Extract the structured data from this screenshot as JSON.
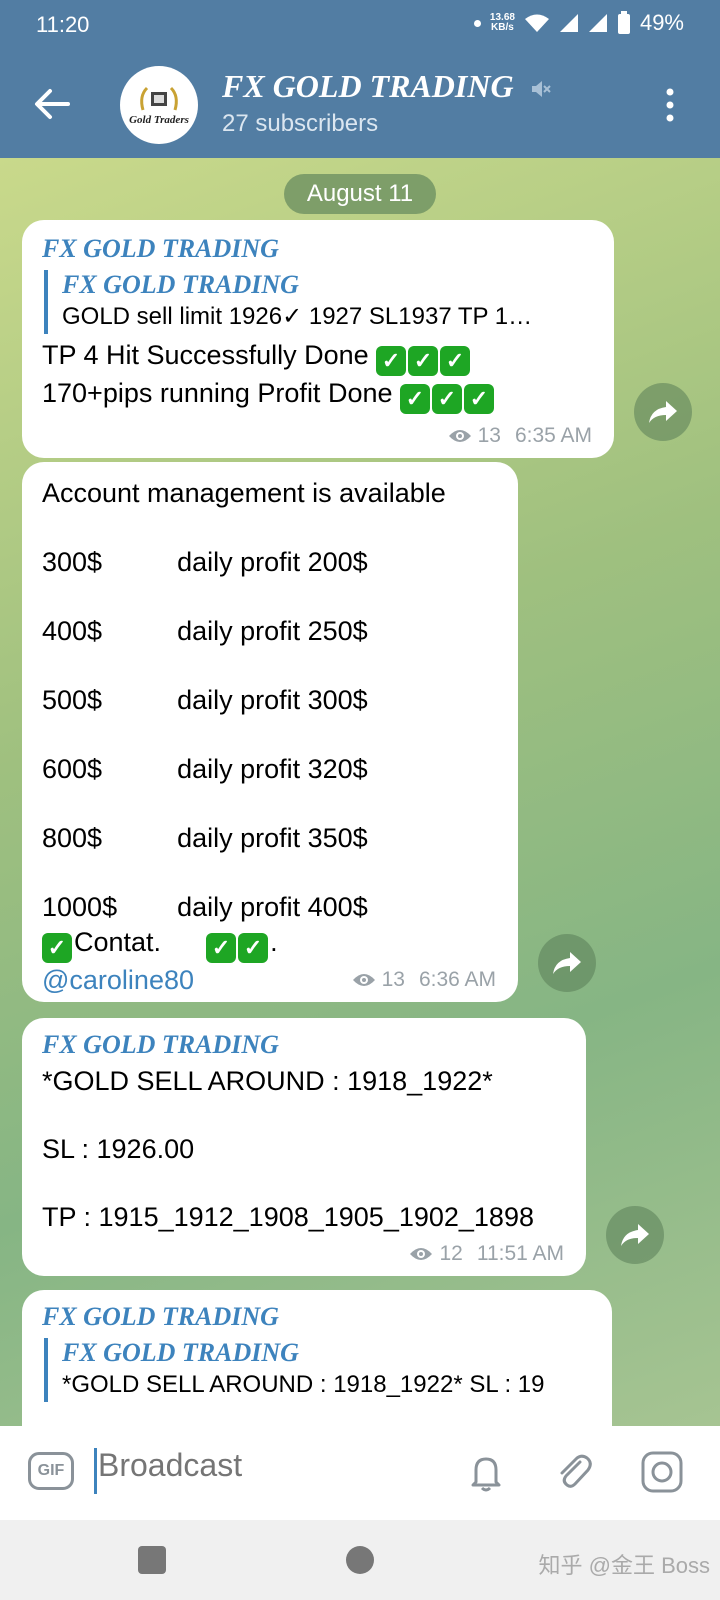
{
  "status_bar": {
    "time": "11:20",
    "net_speed_value": "13.68",
    "net_speed_unit": "KB/s",
    "battery": "49%"
  },
  "header": {
    "title": "FX GOLD TRADING",
    "subtitle": "27 subscribers",
    "avatar_text": "Gold Traders"
  },
  "chat": {
    "date_label": "August 11",
    "messages": [
      {
        "sender": "FX GOLD TRADING",
        "reply_sender": "FX GOLD TRADING",
        "reply_text": "GOLD sell  limit 1926✓ 1927   SL1937   TP 1…",
        "line1": "TP 4 Hit Successfully Done ",
        "line2": "170+pips running Profit Done ",
        "views": "13",
        "time": "6:35 AM"
      },
      {
        "lines": [
          "Account management is available",
          "",
          "300$          daily profit 200$",
          "",
          "400$          daily profit 250$",
          "",
          "500$          daily profit 300$",
          "",
          "600$          daily profit 320$",
          "",
          "800$          daily profit 350$",
          "",
          "1000$        daily profit 400$"
        ],
        "contact_text": "Contat.      ",
        "contact_end": ".",
        "mention": "@caroline80",
        "views": "13",
        "time": "6:36 AM"
      },
      {
        "sender": "FX GOLD TRADING",
        "text": "*GOLD SELL AROUND : 1918_1922*\n\nSL : 1926.00\n\nTP : 1915_1912_1908_1905_1902_1898",
        "views": "12",
        "time": "11:51 AM"
      },
      {
        "sender": "FX GOLD TRADING",
        "reply_sender": "FX GOLD TRADING",
        "reply_text": "*GOLD SELL AROUND : 1918_1922*  SL : 19"
      }
    ]
  },
  "input": {
    "gif_label": "GIF",
    "placeholder": "Broadcast"
  },
  "watermark": "知乎 @金王 Boss",
  "colors": {
    "header_bg": "#527da3",
    "accent": "#3d83bd",
    "check_green": "#1ea624"
  }
}
